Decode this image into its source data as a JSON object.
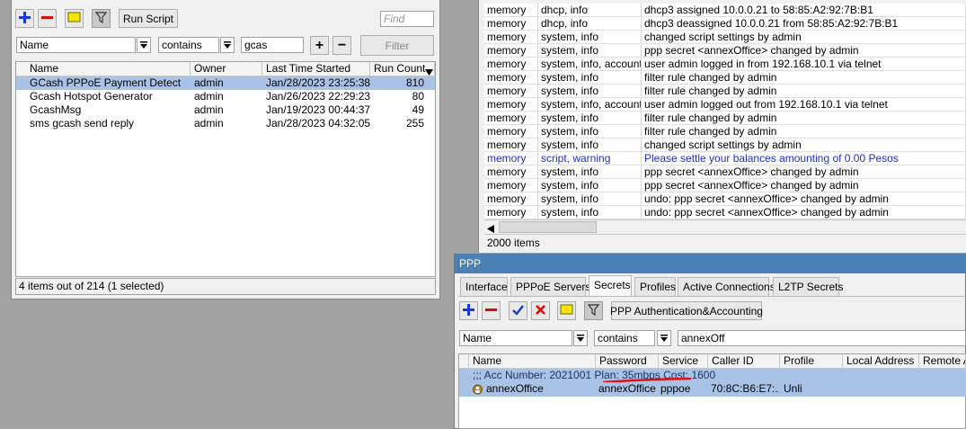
{
  "scripts_window": {
    "toolbar": {
      "run_script_label": "Run Script",
      "find_placeholder": "Find"
    },
    "filter": {
      "field": "Name",
      "operator": "contains",
      "value": "gcas",
      "filter_button": "Filter"
    },
    "columns": [
      "Name",
      "Owner",
      "Last Time Started",
      "Run Count"
    ],
    "rows": [
      {
        "name": "GCash PPPoE Payment Detect",
        "owner": "admin",
        "last_started": "Jan/28/2023 23:25:38",
        "run_count": "810",
        "selected": true
      },
      {
        "name": "Gcash Hotspot Generator",
        "owner": "admin",
        "last_started": "Jan/26/2023 22:29:23",
        "run_count": "80",
        "selected": false
      },
      {
        "name": "GcashMsg",
        "owner": "admin",
        "last_started": "Jan/19/2023 00:44:37",
        "run_count": "49",
        "selected": false
      },
      {
        "name": "sms gcash send reply",
        "owner": "admin",
        "last_started": "Jan/28/2023 04:32:05",
        "run_count": "255",
        "selected": false
      }
    ],
    "status": "4 items out of 214 (1 selected)"
  },
  "log_window": {
    "rows": [
      {
        "buffer": "memory",
        "topics": "dhcp, info",
        "message": "dhcp3 assigned 10.0.0.21 to 58:85:A2:92:7B:B1",
        "warn": false
      },
      {
        "buffer": "memory",
        "topics": "dhcp, info",
        "message": "dhcp3 deassigned 10.0.0.21 from 58:85:A2:92:7B:B1",
        "warn": false
      },
      {
        "buffer": "memory",
        "topics": "system, info",
        "message": "changed script settings by admin",
        "warn": false
      },
      {
        "buffer": "memory",
        "topics": "system, info",
        "message": "ppp secret <annexOffice> changed by admin",
        "warn": false
      },
      {
        "buffer": "memory",
        "topics": "system, info, account",
        "message": "user admin logged in from 192.168.10.1 via telnet",
        "warn": false
      },
      {
        "buffer": "memory",
        "topics": "system, info",
        "message": "filter rule changed by admin",
        "warn": false
      },
      {
        "buffer": "memory",
        "topics": "system, info",
        "message": "filter rule changed by admin",
        "warn": false
      },
      {
        "buffer": "memory",
        "topics": "system, info, account",
        "message": "user admin logged out from 192.168.10.1 via telnet",
        "warn": false
      },
      {
        "buffer": "memory",
        "topics": "system, info",
        "message": "filter rule changed by admin",
        "warn": false
      },
      {
        "buffer": "memory",
        "topics": "system, info",
        "message": "filter rule changed by admin",
        "warn": false
      },
      {
        "buffer": "memory",
        "topics": "system, info",
        "message": "changed script settings by admin",
        "warn": false
      },
      {
        "buffer": "memory",
        "topics": "script, warning",
        "message": "Please settle your balances amounting of 0.00 Pesos",
        "warn": true
      },
      {
        "buffer": "memory",
        "topics": "system, info",
        "message": "ppp secret <annexOffice> changed by admin",
        "warn": false
      },
      {
        "buffer": "memory",
        "topics": "system, info",
        "message": "ppp secret <annexOffice> changed by admin",
        "warn": false
      },
      {
        "buffer": "memory",
        "topics": "system, info",
        "message": "undo: ppp secret <annexOffice> changed by admin",
        "warn": false
      },
      {
        "buffer": "memory",
        "topics": "system, info",
        "message": "undo: ppp secret <annexOffice> changed by admin",
        "warn": false
      }
    ],
    "status": "2000 items"
  },
  "ppp_window": {
    "title": "PPP",
    "tabs": [
      "Interface",
      "PPPoE Servers",
      "Secrets",
      "Profiles",
      "Active Connections",
      "L2TP Secrets"
    ],
    "active_tab": "Secrets",
    "auth_button": "PPP Authentication&Accounting",
    "filter": {
      "field": "Name",
      "operator": "contains",
      "value": "annexOff"
    },
    "columns": [
      "Name",
      "Password",
      "Service",
      "Caller ID",
      "Profile",
      "Local Address",
      "Remote Ad"
    ],
    "comment": ";;; Acc Number: 2021001 Plan: 35mbps Cost: 1600",
    "secret": {
      "name": "annexOffice",
      "password": "annexOffice",
      "service": "pppoe",
      "caller_id": "70:8C:B6:E7:...",
      "profile": "Unli"
    }
  },
  "colors": {
    "selection": "#a9c3e6",
    "warning_text": "#1f2fd6",
    "annotation": "#e01010",
    "desktop": "#a3a3a3"
  }
}
